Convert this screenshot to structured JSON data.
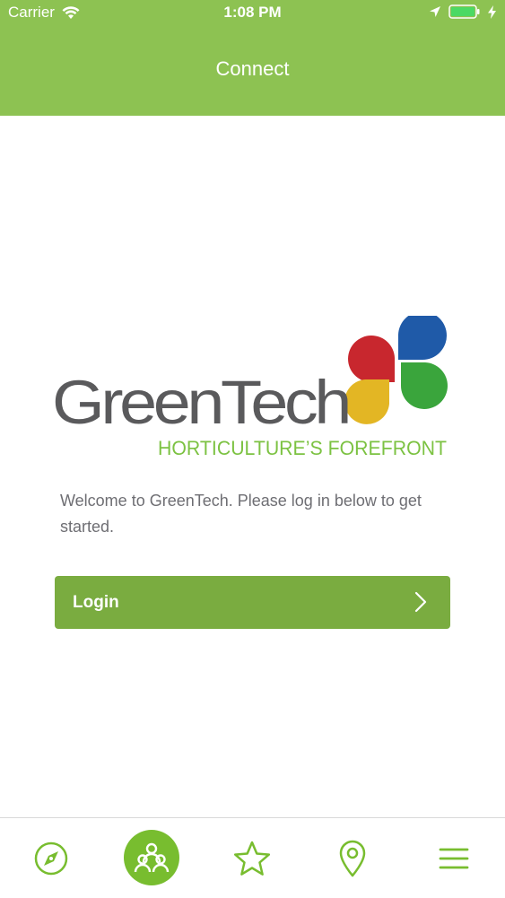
{
  "status_bar": {
    "carrier": "Carrier",
    "time": "1:08 PM",
    "icons": [
      "wifi-icon",
      "location-arrow-icon",
      "battery-icon",
      "charging-bolt-icon"
    ]
  },
  "nav": {
    "title": "Connect"
  },
  "logo": {
    "wordmark": "GreenTech",
    "tagline": "HORTICULTURE’S FOREFRONT",
    "petal_colors": [
      "#c8272e",
      "#1f5aa8",
      "#3aa53c",
      "#e3b624"
    ]
  },
  "main": {
    "welcome_text": "Welcome to GreenTech. Please log in below to get started.",
    "login_label": "Login"
  },
  "tab_bar": {
    "items": [
      {
        "icon": "compass-icon",
        "active": false
      },
      {
        "icon": "people-icon",
        "active": true
      },
      {
        "icon": "star-icon",
        "active": false
      },
      {
        "icon": "map-pin-icon",
        "active": false
      },
      {
        "icon": "menu-icon",
        "active": false
      }
    ]
  },
  "colors": {
    "header": "#8dc252",
    "button": "#7aac40",
    "tab_icon": "#78bd2f",
    "logo_gray": "#5a5a5c",
    "logo_green": "#7cc242"
  }
}
